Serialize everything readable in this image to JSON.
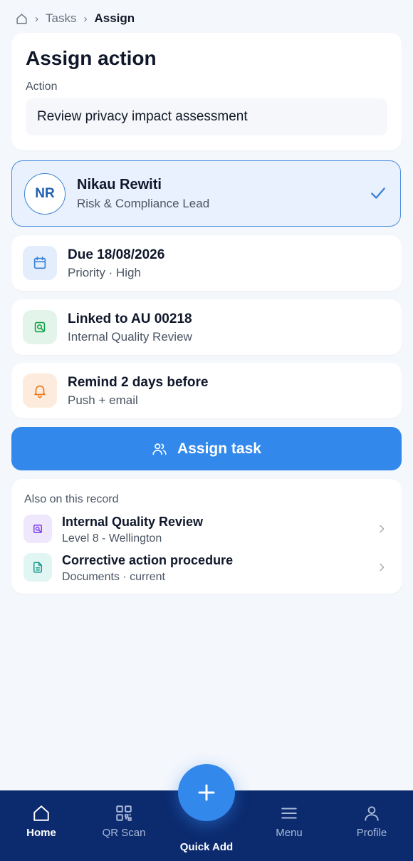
{
  "breadcrumb": {
    "items": [
      "Tasks",
      "Assign"
    ]
  },
  "assign": {
    "title": "Assign action",
    "action_label": "Action",
    "action_value": "Review privacy impact assessment"
  },
  "assignee": {
    "initials": "NR",
    "name": "Nikau Rewiti",
    "role": "Risk & Compliance Lead",
    "selected": true
  },
  "details": [
    {
      "icon": "calendar-icon",
      "title": "Due 18/08/2026",
      "subtitle": "Priority · High"
    },
    {
      "icon": "audit-search-icon",
      "title": "Linked to AU 00218",
      "subtitle": "Internal Quality Review"
    },
    {
      "icon": "bell-icon",
      "title": "Remind 2 days before",
      "subtitle": "Push + email"
    }
  ],
  "assign_button": {
    "label": "Assign task"
  },
  "also": {
    "header": "Also on this record",
    "items": [
      {
        "icon": "audit-search-icon",
        "title": "Internal Quality Review",
        "subtitle": "Level 8 - Wellington"
      },
      {
        "icon": "document-icon",
        "title": "Corrective action procedure",
        "subtitle": "Documents · current"
      }
    ]
  },
  "nav": {
    "items": [
      {
        "label": "Home",
        "icon": "home-icon",
        "active": true
      },
      {
        "label": "QR Scan",
        "icon": "qr-icon",
        "active": false
      },
      {
        "label": "Menu",
        "icon": "menu-icon",
        "active": false
      },
      {
        "label": "Profile",
        "icon": "profile-icon",
        "active": false
      }
    ],
    "quick_add": "Quick Add"
  },
  "colors": {
    "accent": "#3388ec",
    "nav_background": "#0c2a6e",
    "selected_background": "#e8f1fd",
    "selected_border": "#4a8ee0"
  }
}
